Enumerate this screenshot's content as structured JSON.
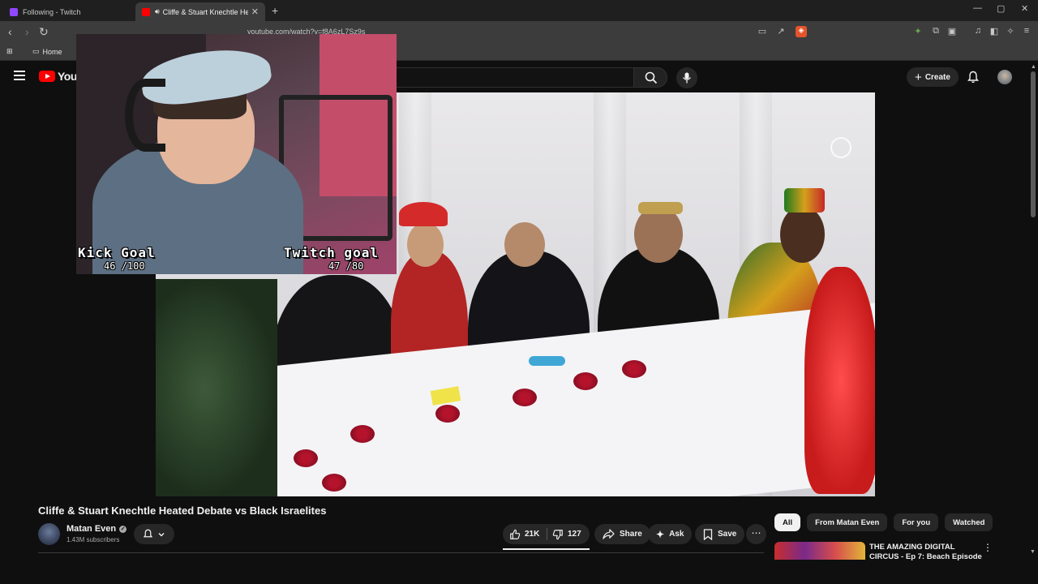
{
  "browser": {
    "tabs": [
      {
        "title": "Following - Twitch",
        "favicon_color": "#9146ff"
      },
      {
        "title": "Cliffe & Stuart Knechtle Heate",
        "favicon_color": "#ff0000"
      }
    ],
    "new_tab": "+",
    "window_controls": {
      "minimize": "—",
      "maximize": "▢",
      "close": "✕"
    },
    "nav": {
      "back": "‹",
      "forward": "›",
      "reload": "↻"
    },
    "url": "youtube.com/watch?v=f8A6zL7Sz9s",
    "bookmarks": [
      {
        "label": "Home"
      }
    ]
  },
  "youtube": {
    "logo_text": "YouTube",
    "header": {
      "create_label": "Create"
    },
    "video": {
      "title": "Cliffe & Stuart Knechtle Heated Debate vs Black Israelites"
    },
    "channel": {
      "name": "Matan Even",
      "verified": "✓",
      "subscribers": "1.43M subscribers"
    },
    "actions": {
      "likes": "21K",
      "dislikes": "127",
      "share": "Share",
      "ask": "Ask",
      "save": "Save",
      "more": "⋯"
    },
    "chips": [
      "All",
      "From Matan Even",
      "For you",
      "Watched"
    ],
    "recommendation": {
      "title": "THE AMAZING DIGITAL CIRCUS - Ep 7: Beach Episode",
      "menu": "⋮"
    }
  },
  "stream_overlay": {
    "kick_label": "Kick Goal",
    "kick_count": "46 /100",
    "kick_progress": 0.46,
    "twitch_label": "Twitch goal",
    "twitch_count": "47 /80",
    "twitch_progress": 0.5875
  },
  "colors": {
    "yt_bg": "#0f0f0f",
    "yt_red": "#ff0000",
    "pill_bg": "#272727",
    "chrome_bg": "#3c3c3c"
  }
}
